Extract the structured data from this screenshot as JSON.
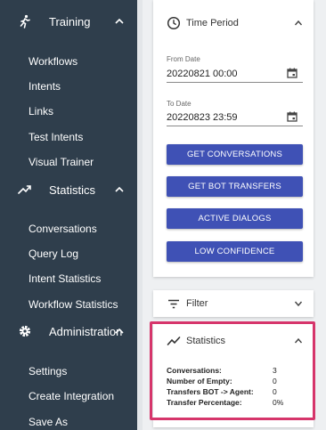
{
  "sidebar": {
    "training": {
      "label": "Training",
      "items": [
        "Workflows",
        "Intents",
        "Links",
        "Test Intents",
        "Visual Trainer"
      ]
    },
    "statistics": {
      "label": "Statistics",
      "items": [
        "Conversations",
        "Query Log",
        "Intent Statistics",
        "Workflow Statistics"
      ]
    },
    "administration": {
      "label": "Administration",
      "items": [
        "Settings",
        "Create Integration",
        "Save As"
      ]
    }
  },
  "time_period": {
    "title": "Time Period",
    "from_label": "From Date",
    "from_value": "20220821 00:00",
    "to_label": "To Date",
    "to_value": "20220823 23:59",
    "buttons": [
      "GET CONVERSATIONS",
      "GET BOT TRANSFERS",
      "ACTIVE DIALOGS",
      "LOW CONFIDENCE"
    ]
  },
  "filter": {
    "title": "Filter"
  },
  "statistics_panel": {
    "title": "Statistics",
    "rows": [
      {
        "label": "Conversations:",
        "value": "3"
      },
      {
        "label": "Number of Empty:",
        "value": "0"
      },
      {
        "label": "Transfers BOT -> Agent:",
        "value": "0"
      },
      {
        "label": "Transfer Percentage:",
        "value": "0%"
      }
    ]
  },
  "colors": {
    "sidebar_bg": "#2f3e4c",
    "button_bg": "#3f51b5",
    "highlight_border": "#d6356b"
  }
}
